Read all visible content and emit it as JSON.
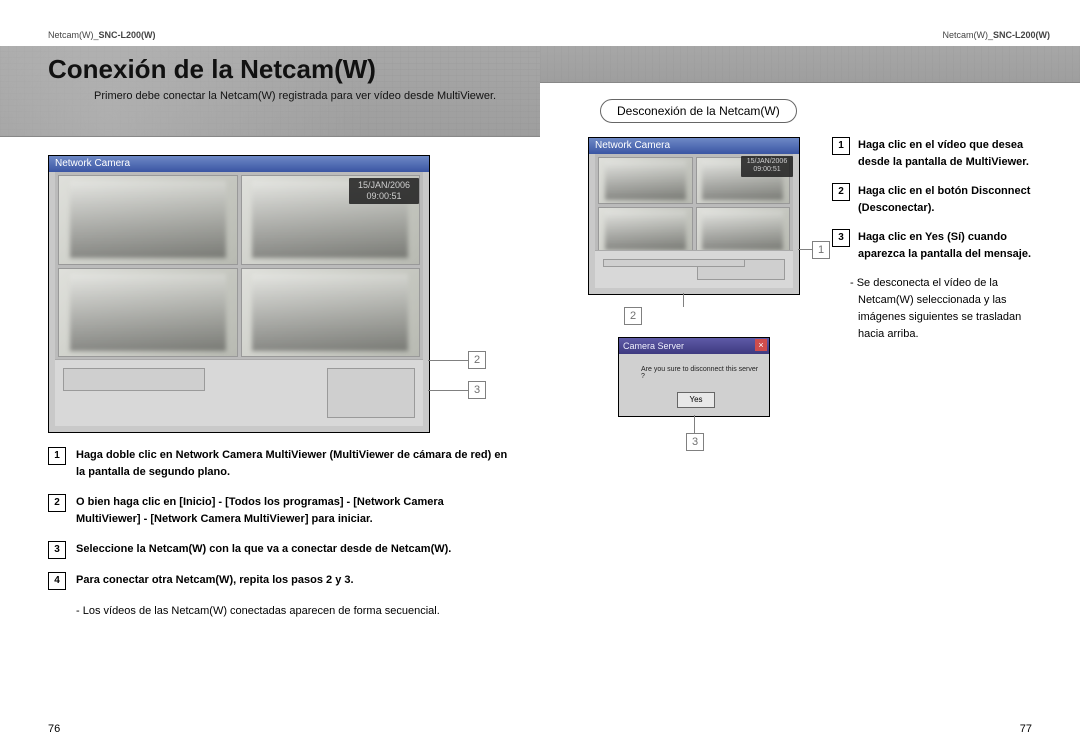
{
  "header_left": {
    "product": "Netcam(W)",
    "model": "SNC-L200(W)"
  },
  "header_right": {
    "product": "Netcam(W)",
    "model": "SNC-L200(W)"
  },
  "title": "Conexión de la Netcam(W)",
  "lead": "Primero debe conectar la Netcam(W) registrada para ver vídeo desde MultiViewer.",
  "screenshot": {
    "title": "Network Camera",
    "date": "15/JAN/2006",
    "time": "09:00:51"
  },
  "callouts_left": {
    "a": "2",
    "b": "3"
  },
  "steps_left": [
    {
      "n": "1",
      "text": "Haga doble clic en Network Camera MultiViewer (MultiViewer de cámara de red) en la pantalla de segundo plano."
    },
    {
      "n": "2",
      "text": "O bien haga clic en [Inicio] - [Todos los programas] - [Network Camera MultiViewer] - [Network Camera MultiViewer] para iniciar."
    },
    {
      "n": "3",
      "text": "Seleccione la Netcam(W) con la que va a conectar desde de Netcam(W)."
    },
    {
      "n": "4",
      "text": "Para conectar otra Netcam(W), repita los pasos 2 y 3."
    }
  ],
  "note_left": "- Los vídeos de las Netcam(W) conectadas aparecen de forma secuencial.",
  "page_num_left": "76",
  "page_num_right": "77",
  "disc_heading": "Desconexión de la Netcam(W)",
  "screenshot2": {
    "title": "Network Camera",
    "date": "15/JAN/2006",
    "time": "09:00:51"
  },
  "callouts_right": {
    "a": "1",
    "b": "2",
    "c": "3"
  },
  "dialog": {
    "title": "Camera Server",
    "msg": "Are you sure to disconnect this server ?",
    "yes": "Yes"
  },
  "steps_right": [
    {
      "n": "1",
      "text": "Haga clic en el vídeo que desea desde la pantalla de MultiViewer."
    },
    {
      "n": "2",
      "text": "Haga clic en el botón Disconnect (Desconectar)."
    },
    {
      "n": "3",
      "text": "Haga clic en Yes (Sí) cuando aparezca la pantalla del mensaje."
    }
  ],
  "subnote_right": "- Se desconecta el vídeo de la Netcam(W) seleccionada y las imágenes siguientes se trasladan hacia arriba."
}
